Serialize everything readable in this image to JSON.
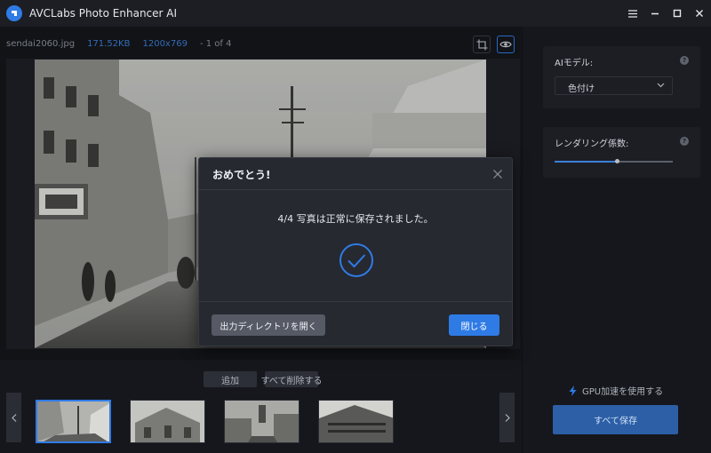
{
  "app": {
    "title": "AVCLabs Photo Enhancer AI",
    "logo_icon": "avclabs-logo-icon"
  },
  "window_controls": [
    "menu-icon",
    "minimize-icon",
    "maximize-icon",
    "close-icon"
  ],
  "file_info": {
    "name": "sendai2060.jpg",
    "size": "171.52KB",
    "dimensions": "1200x769",
    "position": "- 1 of 4"
  },
  "toolbar": {
    "crop_icon": "crop-icon",
    "preview_icon": "eye-icon"
  },
  "right_panel": {
    "ai_model": {
      "label": "AIモデル:",
      "selected": "色付け"
    },
    "rendering": {
      "label": "レンダリング係数:",
      "value_fraction": 0.53
    },
    "gpu_label": "GPU加速を使用する",
    "save_all_label": "すべて保存"
  },
  "bottom": {
    "add_label": "追加",
    "clear_label": "すべて削除する",
    "thumbnails": [
      {
        "name": "sendai2060.jpg",
        "active": true
      },
      {
        "name": "thumbnail-2",
        "active": false
      },
      {
        "name": "thumbnail-3",
        "active": false
      },
      {
        "name": "thumbnail-4",
        "active": false
      }
    ]
  },
  "dialog": {
    "title": "おめでとう!",
    "message": "4/4 写真は正常に保存されました。",
    "open_dir_label": "出力ディレクトリを開く",
    "close_label": "閉じる"
  },
  "colors": {
    "accent": "#2f7be6",
    "background": "#15171c",
    "panel": "#1c1e24",
    "dialog": "#262930"
  }
}
